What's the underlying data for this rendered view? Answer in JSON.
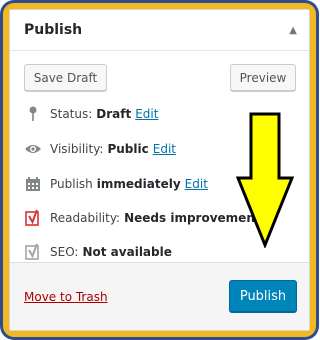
{
  "metabox": {
    "title": "Publish"
  },
  "actions": {
    "save_draft": "Save Draft",
    "preview": "Preview"
  },
  "rows": [
    {
      "icon": "pin-icon",
      "label": "Status:",
      "value": "Draft",
      "link": "Edit"
    },
    {
      "icon": "eye-icon",
      "label": "Visibility:",
      "value": "Public",
      "link": "Edit"
    },
    {
      "icon": "calendar-icon",
      "label": "Publish",
      "value": "immediately",
      "link": "Edit"
    },
    {
      "icon": "yoast-icon",
      "label": "Readability:",
      "value": "Needs improvement",
      "link": ""
    },
    {
      "icon": "yoast-icon",
      "label": "SEO:",
      "value": "Not available",
      "link": ""
    }
  ],
  "footer": {
    "trash": "Move to Trash",
    "publish": "Publish"
  },
  "colors": {
    "frame": "#2e4c8f",
    "border": "#f2b81f",
    "primary": "#0085ba",
    "link": "#0073aa",
    "trash": "#aa0000",
    "arrow": "#ffff00",
    "readability_bad": "#dc3232"
  }
}
